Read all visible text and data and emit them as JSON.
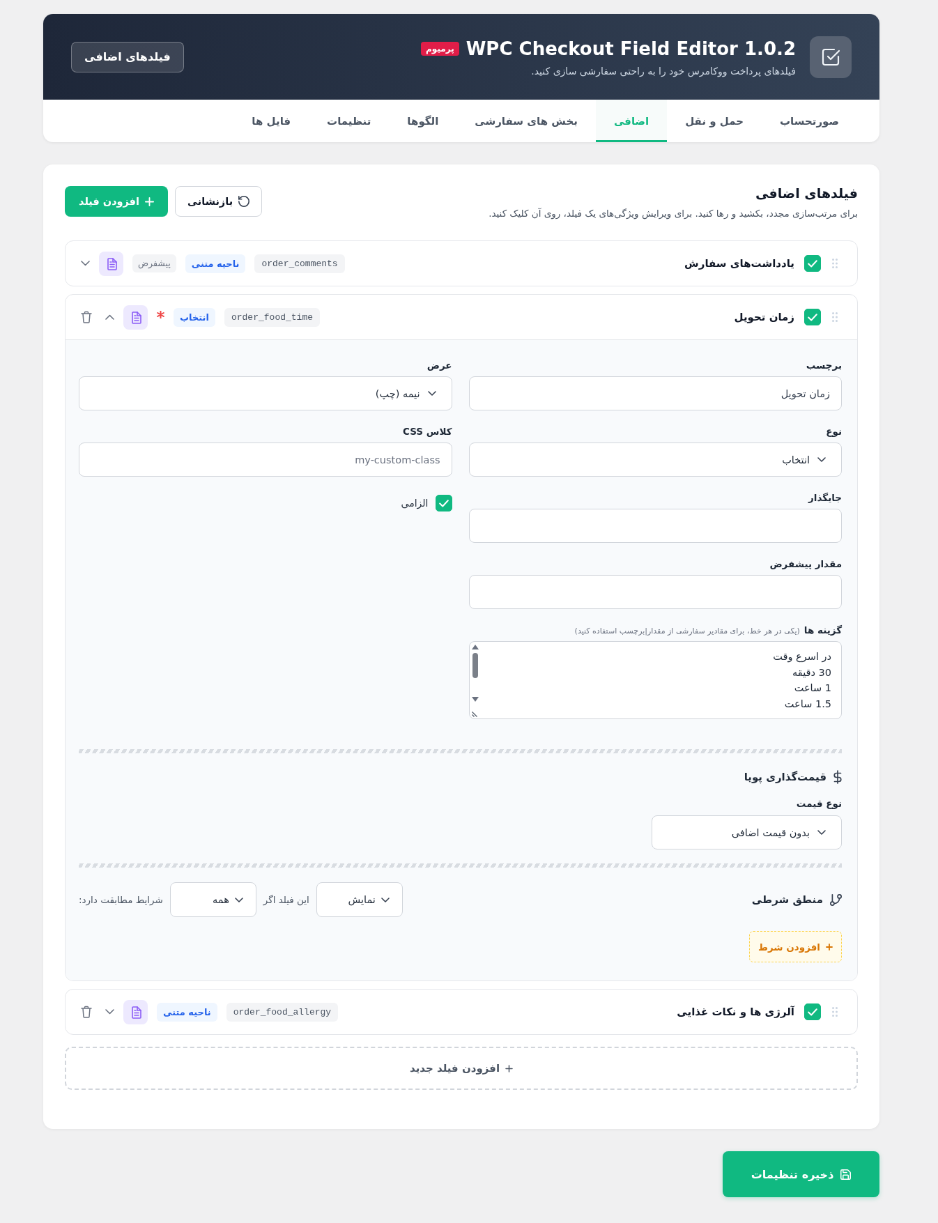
{
  "header": {
    "title": "WPC Checkout Field Editor 1.0.2",
    "badge": "پرمیوم",
    "subtitle": "فیلدهای پرداخت ووکامرس خود را به راحتی سفارشی سازی کنید.",
    "section_button": "فیلدهای اضافی"
  },
  "tabs": [
    {
      "label": "صورتحساب",
      "selected": false
    },
    {
      "label": "حمل و نقل",
      "selected": false
    },
    {
      "label": "اضافی",
      "selected": true
    },
    {
      "label": "بخش های سفارشی",
      "selected": false
    },
    {
      "label": "الگوها",
      "selected": false
    },
    {
      "label": "تنظیمات",
      "selected": false
    },
    {
      "label": "فایل ها",
      "selected": false
    }
  ],
  "panel": {
    "title": "فیلدهای اضافی",
    "description": "برای مرتب‌سازی مجدد، بکشید و رها کنید. برای ویرایش ویژگی‌های یک فیلد، روی آن کلیک کنید.",
    "reset_button": "بازنشانی",
    "add_button": "افزودن فیلد"
  },
  "fields": [
    {
      "label": "یادداشت‌های سفارش",
      "enabled": true,
      "key": "order_comments",
      "type": "ناحیه متنی",
      "default_badge": "پیشفرض",
      "required": false,
      "expanded": false,
      "deletable": false
    },
    {
      "label": "زمان تحویل",
      "enabled": true,
      "key": "order_food_time",
      "type": "انتخاب",
      "required": true,
      "expanded": true,
      "deletable": true,
      "editor": {
        "columns": [
          {
            "items": [
              {
                "kind": "input",
                "label": "برچسب",
                "value": "زمان تحویل"
              },
              {
                "kind": "select",
                "label": "نوع",
                "value": "انتخاب"
              },
              {
                "kind": "input",
                "label": "جایگذار"
              },
              {
                "kind": "input",
                "label": "مقدار پیشفرض"
              },
              {
                "kind": "textarea",
                "label": "گزینه ها",
                "hint": "(یکی در هر خط، برای مقادیر سفارشی از مقدار|برچسب استفاده کنید)",
                "lines": [
                  "در اسرع وقت",
                  "30 دقیقه",
                  "1 ساعت",
                  "1.5 ساعت"
                ]
              }
            ]
          },
          {
            "items": [
              {
                "kind": "select",
                "label": "عرض",
                "value": "نیمه (چپ)"
              },
              {
                "kind": "input",
                "label": "کلاس CSS",
                "placeholder": "my-custom-class"
              },
              {
                "kind": "checkbox",
                "label": "الزامی",
                "checked": true
              }
            ]
          }
        ],
        "pricing": {
          "title": "قیمت‌گذاری پویا",
          "type_label": "نوع قیمت",
          "type_value": "بدون قیمت اضافی"
        },
        "conditions": {
          "title": "منطق شرطی",
          "action": "نمایش",
          "text_before": "این فیلد اگر",
          "match": "همه",
          "text_after": "شرایط مطابقت دارد:",
          "add_button": "افزودن شرط"
        }
      }
    },
    {
      "label": "آلرژی ها و نکات غذایی",
      "enabled": true,
      "key": "order_food_allergy",
      "type": "ناحیه متنی",
      "required": false,
      "expanded": false,
      "deletable": true
    }
  ],
  "add_field_button": "افزودن فیلد جدید",
  "save_button": "ذخیره تنظیمات"
}
